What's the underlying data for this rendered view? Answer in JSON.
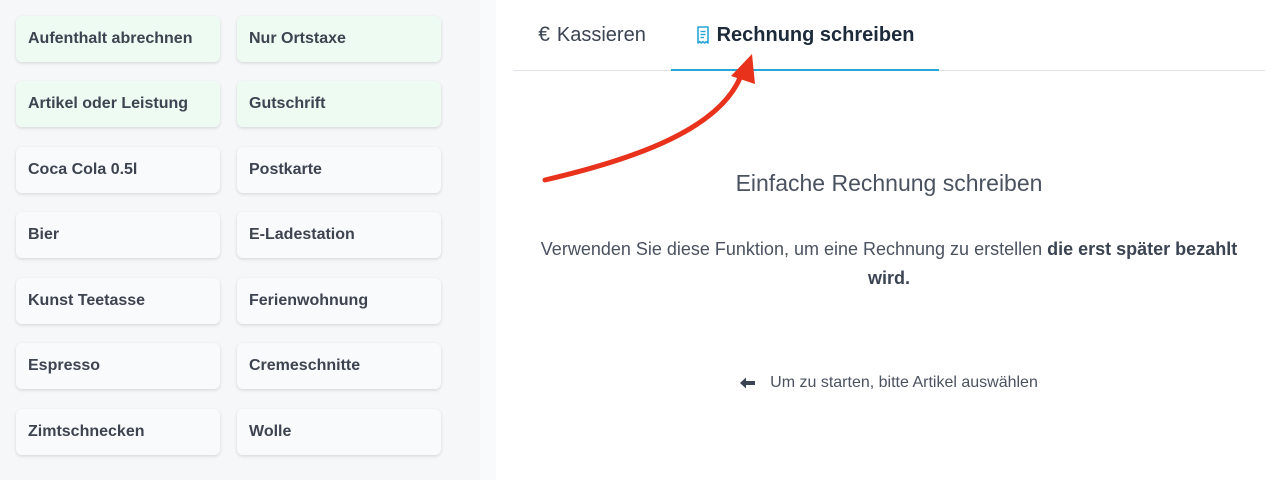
{
  "items": [
    {
      "label": "Aufenthalt abrechnen"
    },
    {
      "label": "Nur Ortstaxe"
    },
    {
      "label": "Artikel oder Leistung"
    },
    {
      "label": "Gutschrift"
    },
    {
      "label": "Coca Cola 0.5l"
    },
    {
      "label": "Postkarte"
    },
    {
      "label": "Bier"
    },
    {
      "label": "E-Ladestation"
    },
    {
      "label": "Kunst Teetasse"
    },
    {
      "label": "Ferienwohnung"
    },
    {
      "label": "Espresso"
    },
    {
      "label": "Cremeschnitte"
    },
    {
      "label": "Zimtschnecken"
    },
    {
      "label": "Wolle"
    }
  ],
  "tabs": {
    "kassieren": {
      "label": "Kassieren",
      "icon": "euro-icon"
    },
    "rechnung": {
      "label": "Rechnung schreiben",
      "icon": "receipt-icon",
      "active": true
    }
  },
  "main": {
    "title": "Einfache Rechnung schreiben",
    "description_prefix": "Verwenden Sie diese Funktion, um eine Rechnung zu erstellen",
    "description_bold": "die erst später bezahlt wird.",
    "hint": "Um zu starten, bitte Artikel auswählen",
    "hint_icon": "arrow-left-icon"
  },
  "colors": {
    "accent": "#29a6d9",
    "annotation_arrow": "#e8321b",
    "special_item_bg": "#eefbf3"
  }
}
